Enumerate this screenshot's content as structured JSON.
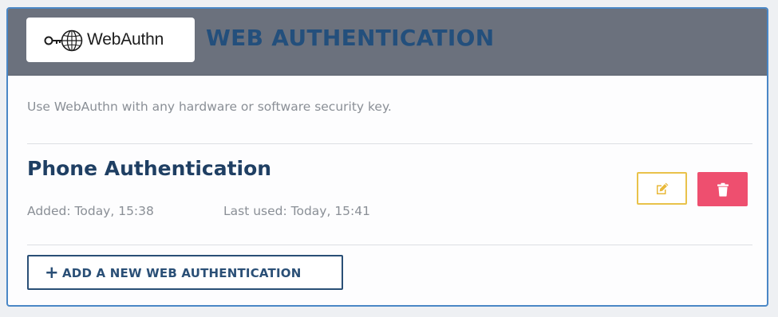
{
  "header": {
    "logo_text": "WebAuthn",
    "logo_icon": "webauthn-key-globe-icon",
    "title": "WEB AUTHENTICATION"
  },
  "description": "Use WebAuthn with any hardware or software security key.",
  "keys": [
    {
      "name": "Phone Authentication",
      "added": "Added: Today, 15:38",
      "last_used": "Last used: Today, 15:41",
      "edit_icon": "pencil-square-icon",
      "delete_icon": "trash-icon"
    }
  ],
  "add_button": {
    "icon": "plus-icon",
    "label": "ADD A NEW WEB AUTHENTICATION"
  },
  "colors": {
    "header_bg": "#6b717d",
    "title": "#234f7c",
    "card_border": "#4a87c6",
    "edit_border": "#e9c24a",
    "delete_bg": "#ee4f6f",
    "primary_dark": "#2a4f76"
  }
}
